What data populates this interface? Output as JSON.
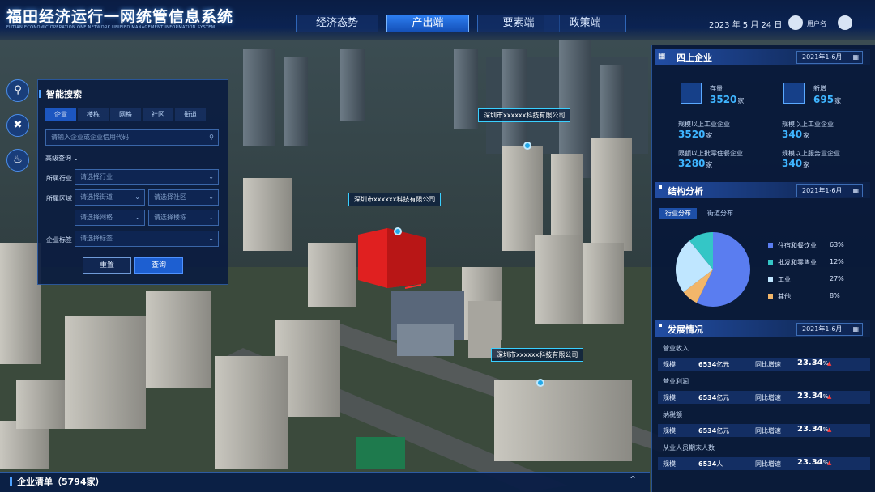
{
  "header": {
    "title": "福田经济运行一网统管信息系统",
    "subtitle": "FUTIAN ECONOMIC OPERATION ONE NETWORK UNIFIED MANAGEMENT INFORMATION SYSTEM",
    "tabs": [
      {
        "label": "经济态势",
        "active": false
      },
      {
        "label": "产出端",
        "active": true
      },
      {
        "label": "要素端",
        "active": false
      },
      {
        "label": "政策端",
        "active": false
      }
    ],
    "date": "2023 年 5 月 24 日",
    "username": "用户名",
    "accent": "#2d7ef0"
  },
  "side_icons": [
    "search-icon",
    "tools-icon",
    "bell-icon"
  ],
  "search_panel": {
    "title": "智能搜索",
    "tabs": [
      "企业",
      "楼栋",
      "网格",
      "社区",
      "街道"
    ],
    "search_placeholder": "请输入企业或企业信用代码",
    "advanced_label": "高级查询",
    "industry_label": "所属行业",
    "industry_placeholder": "请选择行业",
    "region_label": "所属区域",
    "street_placeholder": "请选择街道",
    "community_placeholder": "请选择社区",
    "grid_placeholder": "请选择网格",
    "building_placeholder": "请选择楼栋",
    "tag_label": "企业标签",
    "tag_placeholder": "请选择标签",
    "reset_label": "重置",
    "query_label": "查询"
  },
  "map": {
    "labels": [
      "深圳市xxxxxx科技有限公司",
      "深圳市xxxxxx科技有限公司",
      "深圳市xxxxxx科技有限公司"
    ]
  },
  "enterprises": {
    "title": "四上企业",
    "date_range": "2021年1-6月",
    "stock_label": "存量",
    "stock_value": "3520",
    "new_label": "新增",
    "new_value": "695",
    "unit": "家",
    "items": [
      {
        "label": "规模以上工业企业",
        "value": "3520"
      },
      {
        "label": "规模以上工业企业",
        "value": "340"
      },
      {
        "label": "限额以上批零住餐企业",
        "value": "3280"
      },
      {
        "label": "规模以上服务业企业",
        "value": "340"
      }
    ]
  },
  "structure": {
    "title": "结构分析",
    "date_range": "2021年1-6月",
    "tabs": [
      "行业分布",
      "街道分布"
    ],
    "chart_data": {
      "type": "pie",
      "labels": [
        "住宿和餐饮业",
        "批发和零售业",
        "工业",
        "其他"
      ],
      "values": [
        63,
        12,
        27,
        8
      ],
      "display": [
        "63%",
        "12%",
        "27%",
        "8%"
      ],
      "colors": [
        "#5a7df0",
        "#34c6c6",
        "#bfe6ff",
        "#f2b66a"
      ]
    }
  },
  "development": {
    "title": "发展情况",
    "date_range": "2021年1-6月",
    "rows": [
      {
        "name": "营业收入",
        "scale_label": "规模",
        "scale_value": "6534",
        "scale_unit": "亿元",
        "growth_label": "同比增速",
        "growth_value": "23.34",
        "growth_unit": "%"
      },
      {
        "name": "营业利润",
        "scale_label": "规模",
        "scale_value": "6534",
        "scale_unit": "亿元",
        "growth_label": "同比增速",
        "growth_value": "23.34",
        "growth_unit": "%"
      },
      {
        "name": "纳税额",
        "scale_label": "规模",
        "scale_value": "6534",
        "scale_unit": "亿元",
        "growth_label": "同比增速",
        "growth_value": "23.34",
        "growth_unit": "%"
      },
      {
        "name": "从业人员期末人数",
        "scale_label": "规模",
        "scale_value": "6534",
        "scale_unit": "人",
        "growth_label": "同比增速",
        "growth_value": "23.34",
        "growth_unit": "%"
      }
    ]
  },
  "bottom": {
    "title": "企业清单（5794家）"
  }
}
